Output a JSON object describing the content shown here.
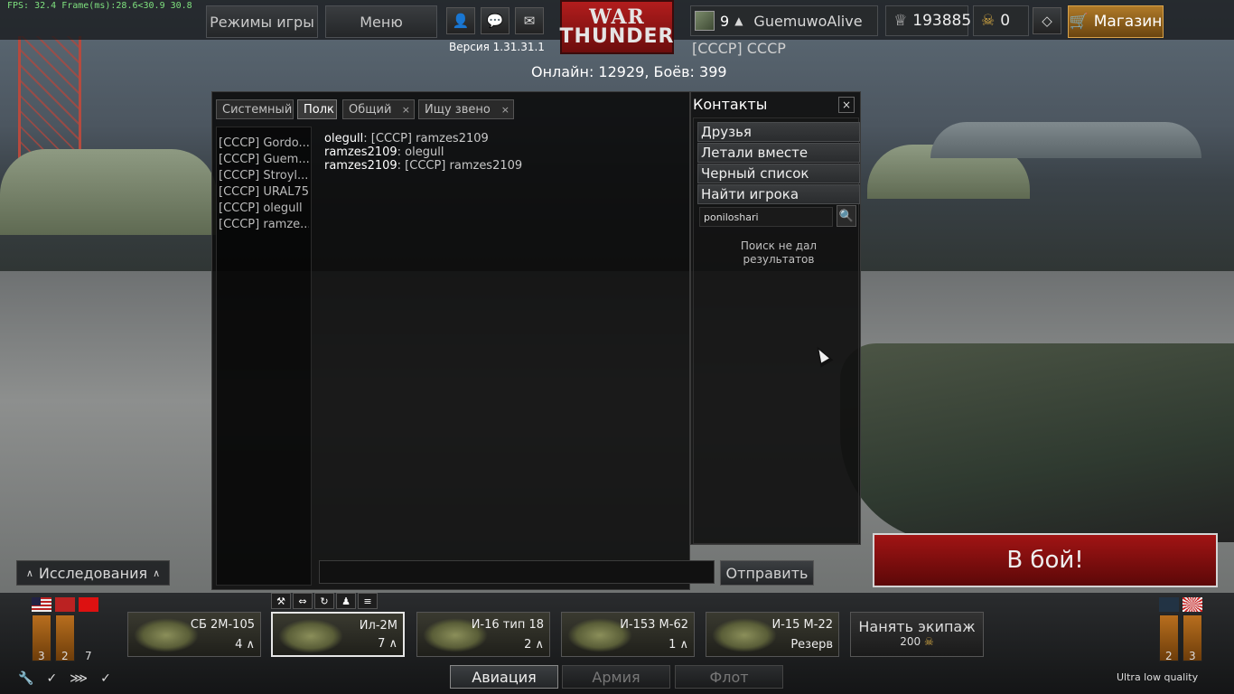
{
  "fps_text": "FPS: 32.4 Frame(ms):28.6<30.9 30.8",
  "topbar": {
    "game_modes": "Режимы игры",
    "menu": "Меню",
    "version": "Версия 1.31.31.1",
    "online": "Онлайн: 12929, Боёв: 399",
    "player_level": "9",
    "player_name": "GuemuwoAlive",
    "squad": "[СССР]  СССР",
    "silver_lions": "193885",
    "golden_eagles": "0",
    "shop": "Магазин",
    "logo_word1": "WAR",
    "logo_word2": "THUNDER"
  },
  "chat": {
    "tabs": [
      {
        "label": "Системный"
      },
      {
        "label": "Полк"
      },
      {
        "label": "Общий"
      },
      {
        "label": "Ищу звено"
      }
    ],
    "close_glyph": "×",
    "members": [
      "[СССР] Gordo...",
      "[СССР] Guem...",
      "[СССР] Stroyl...",
      "[СССР] URAL75",
      "[СССР] olegull",
      "[СССР] ramze..."
    ],
    "messages": [
      {
        "nick": "olegull",
        "text": ": [СССР] ramzes2109"
      },
      {
        "nick": "ramzes2109",
        "text": ": olegull"
      },
      {
        "nick": "ramzes2109",
        "text": ": [СССР] ramzes2109"
      }
    ],
    "send": "Отправить"
  },
  "contacts": {
    "title": "Контакты",
    "groups": [
      "Друзья",
      "Летали вместе",
      "Черный список",
      "Найти игрока"
    ],
    "search_value": "poniloshari",
    "no_results_l1": "Поиск не дал",
    "no_results_l2": "результатов"
  },
  "battle": "В бой!",
  "research": "Исследования",
  "nations": [
    {
      "rank": "3"
    },
    {
      "rank": "2"
    },
    {
      "rank": "7"
    },
    {
      "rank": "2"
    },
    {
      "rank": "3"
    }
  ],
  "vehicles": [
    {
      "name": "СБ 2М-105",
      "count": "4"
    },
    {
      "name": "Ил-2М",
      "count": "7"
    },
    {
      "name": "И-16 тип 18",
      "count": "2"
    },
    {
      "name": "И-153 М-62",
      "count": "1"
    },
    {
      "name": "И-15 М-22",
      "count": "Резерв"
    }
  ],
  "hire": {
    "label": "Нанять экипаж",
    "cost": "200"
  },
  "modes": [
    {
      "label": "Авиация"
    },
    {
      "label": "Армия"
    },
    {
      "label": "Флот"
    }
  ],
  "quality": "Ultra low quality",
  "colors": {
    "accent_red": "#a11414",
    "shop_gold": "#b07a28",
    "fps_green": "#7ee07e"
  }
}
